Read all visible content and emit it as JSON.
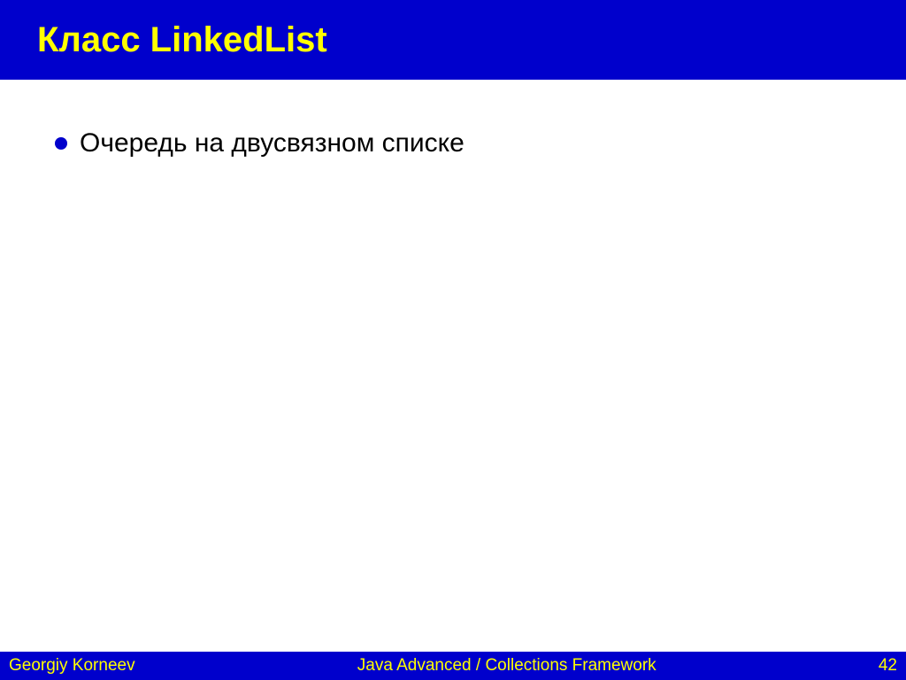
{
  "header": {
    "title": "Класс LinkedList"
  },
  "content": {
    "bullets": [
      {
        "text": "Очередь на двусвязном списке"
      }
    ]
  },
  "footer": {
    "author": "Georgiy Korneev",
    "course": "Java Advanced / Collections Framework",
    "page": "42"
  }
}
